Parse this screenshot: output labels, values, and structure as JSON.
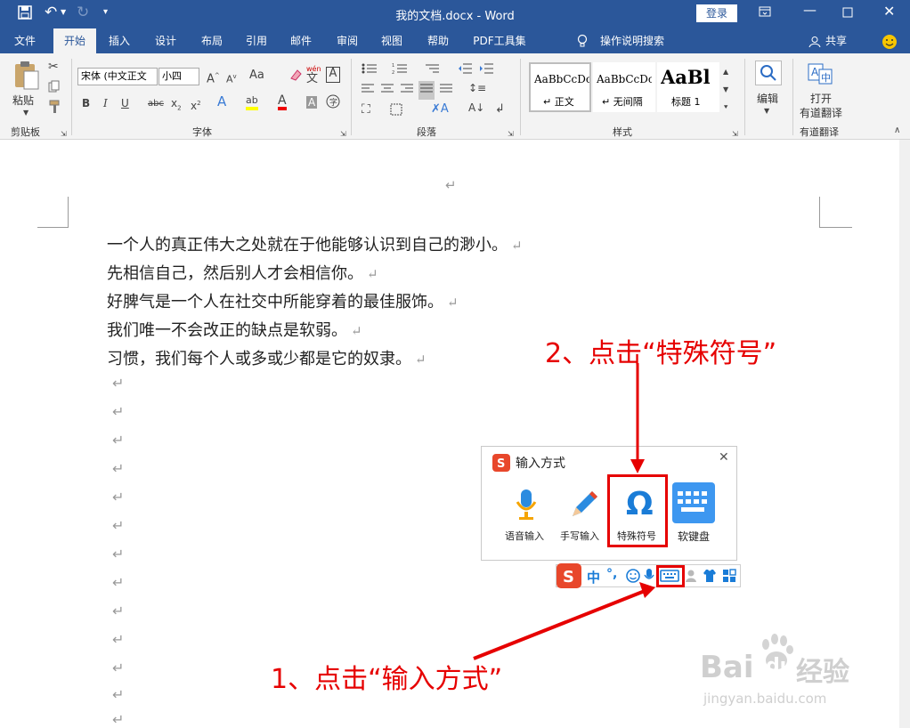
{
  "window": {
    "title": "我的文档.docx  -  Word",
    "login_label": "登录",
    "qat": {
      "save_icon": "save-icon",
      "undo_icon": "undo-icon",
      "redo_icon": "redo-icon",
      "customize_icon": "customize-qat-icon"
    }
  },
  "menu": {
    "tabs": [
      "文件",
      "开始",
      "插入",
      "设计",
      "布局",
      "引用",
      "邮件",
      "审阅",
      "视图",
      "帮助",
      "PDF工具集"
    ],
    "active_tab": "开始",
    "tell_me": "操作说明搜索",
    "share": "共享"
  },
  "ribbon": {
    "clipboard": {
      "paste_label": "粘贴",
      "group_label": "剪贴板"
    },
    "font": {
      "font_name": "宋体 (中文正文",
      "font_size": "小四",
      "aa_label": "Aa",
      "wen_label": "wén",
      "wen_char": "文",
      "group_label": "字体"
    },
    "paragraph": {
      "group_label": "段落"
    },
    "styles": {
      "items": [
        {
          "preview": "AaBbCcDc",
          "label": "↵ 正文"
        },
        {
          "preview": "AaBbCcDc",
          "label": "↵ 无间隔"
        },
        {
          "preview": "AaBl",
          "label": "标题 1"
        }
      ],
      "group_label": "样式"
    },
    "editing": {
      "label": "编辑"
    },
    "youdao": {
      "line1": "打开",
      "line2": "有道翻译",
      "group_label": "有道翻译"
    }
  },
  "document": {
    "lines": [
      "一个人的真正伟大之处就在于他能够认识到自己的渺小。",
      "先相信自己，然后别人才会相信你。",
      "好脾气是一个人在社交中所能穿着的最佳服饰。",
      "我们唯一不会改正的缺点是软弱。",
      "习惯，我们每个人或多或少都是它的奴隶。"
    ],
    "paragraph_mark": "↵"
  },
  "ime_panel": {
    "title": "输入方式",
    "items": [
      {
        "label": "语音输入",
        "icon": "microphone-icon"
      },
      {
        "label": "手写输入",
        "icon": "pencil-icon"
      },
      {
        "label": "特殊符号",
        "icon": "omega-icon"
      },
      {
        "label": "软键盘",
        "icon": "keyboard-icon"
      }
    ],
    "close_icon": "close-icon"
  },
  "ime_bar": {
    "lang": "中",
    "punct": "°,"
  },
  "annotations": {
    "step1": "1、点击“输入方式”",
    "step2": "2、点击“特殊符号”"
  },
  "watermark": {
    "brand": "Bai",
    "brand2": "经验",
    "url": "jingyan.baidu.com"
  },
  "colors": {
    "word_blue": "#2b579a",
    "annot_red": "#e60000",
    "ime_blue": "#1a7cd7",
    "sogou_red": "#e8472b"
  }
}
